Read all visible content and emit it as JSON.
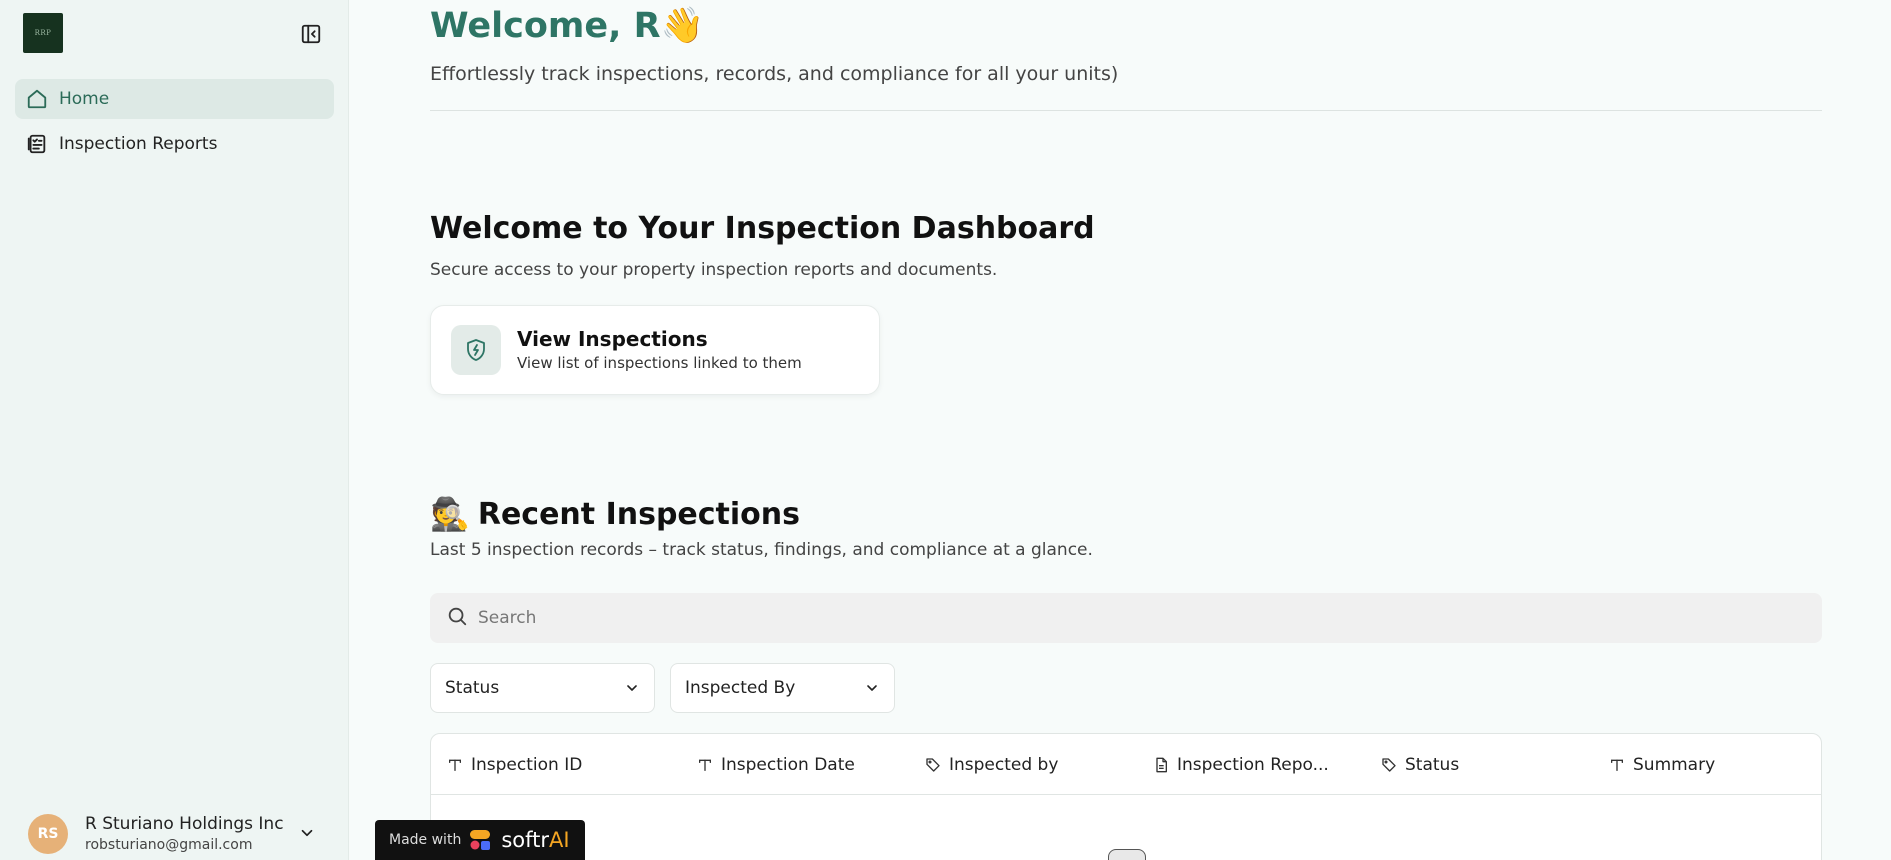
{
  "sidebar": {
    "logo_text": "RRP",
    "items": [
      {
        "label": "Home",
        "icon": "home-icon",
        "active": true
      },
      {
        "label": "Inspection Reports",
        "icon": "report-icon",
        "active": false
      }
    ],
    "user": {
      "initials": "RS",
      "name": "R Sturiano Holdings Inc",
      "email": "robsturiano@gmail.com"
    }
  },
  "header": {
    "welcome": "Welcome, R",
    "wave_emoji": "👋",
    "subtitle": "Effortlessly track inspections, records, and compliance for all your units)"
  },
  "dashboard": {
    "title": "Welcome to Your Inspection Dashboard",
    "subtitle": "Secure access to your property inspection reports and documents.",
    "card": {
      "title": "View Inspections",
      "description": "View list of inspections linked to them",
      "icon": "shield-bolt-icon"
    }
  },
  "recent": {
    "emoji": "🕵️",
    "title": "Recent Inspections",
    "subtitle": "Last 5 inspection records – track status, findings, and compliance at a glance.",
    "search_placeholder": "Search",
    "filters": [
      "Status",
      "Inspected By"
    ],
    "columns": [
      {
        "label": "Inspection ID",
        "icon": "text-type-icon"
      },
      {
        "label": "Inspection Date",
        "icon": "text-type-icon"
      },
      {
        "label": "Inspected by",
        "icon": "tag-icon"
      },
      {
        "label": "Inspection Repo...",
        "icon": "document-icon"
      },
      {
        "label": "Status",
        "icon": "tag-icon"
      },
      {
        "label": "Summary",
        "icon": "text-type-icon"
      }
    ]
  },
  "badge": {
    "made_with": "Made with",
    "brand": "softr",
    "brand_suffix": "AI"
  },
  "colors": {
    "accent": "#2e7565",
    "sidebar_bg": "#eef5f3",
    "active_bg": "#dde9e5",
    "avatar_bg": "#e6b178"
  }
}
